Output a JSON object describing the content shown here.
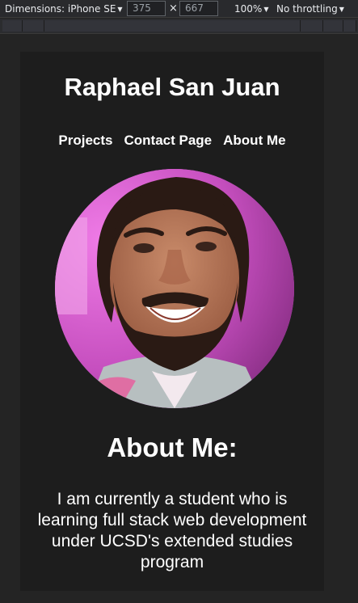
{
  "devtools": {
    "dimensions_label": "Dimensions: iPhone SE",
    "width_value": "375",
    "height_value": "667",
    "times": "×",
    "zoom": "100%",
    "throttling": "No throttling",
    "caret": "▼"
  },
  "site": {
    "title": "Raphael San Juan",
    "nav": [
      "Projects",
      "Contact Page",
      "About Me"
    ],
    "about_heading": "About Me:",
    "about_text": "I am currently a student who is learning full stack web development under UCSD's extended studies program"
  }
}
